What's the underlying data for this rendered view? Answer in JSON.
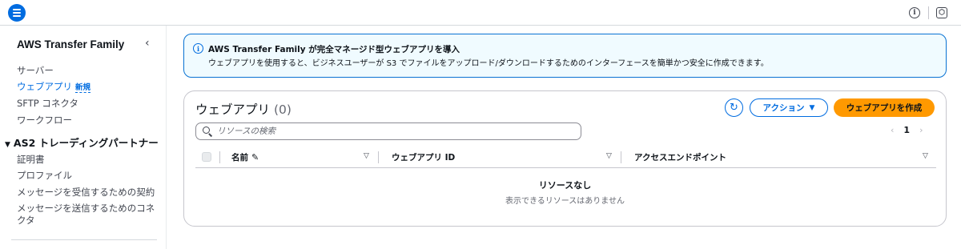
{
  "topbar": {
    "menu_icon": "hamburger-menu-icon",
    "info_icon": "info-icon",
    "settings_icon": "hexagon-gear-icon"
  },
  "sidebar": {
    "title": "AWS Transfer Family",
    "items": [
      {
        "label": "サーバー"
      },
      {
        "label": "ウェブアプリ",
        "badge": "新規",
        "active": true
      },
      {
        "label": "SFTP コネクタ"
      },
      {
        "label": "ワークフロー"
      }
    ],
    "section": {
      "label": "AS2 トレーディングパートナー",
      "items": [
        {
          "label": "証明書"
        },
        {
          "label": "プロファイル"
        },
        {
          "label": "メッセージを受信するための契約"
        },
        {
          "label": "メッセージを送信するためのコネクタ"
        }
      ]
    }
  },
  "banner": {
    "title": "AWS Transfer Family が完全マネージド型ウェブアプリを導入",
    "body": "ウェブアプリを使用すると、ビジネスユーザーが S3 でファイルをアップロード/ダウンロードするためのインターフェースを簡単かつ安全に作成できます。"
  },
  "webapps": {
    "title": "ウェブアプリ",
    "count": "(0)",
    "actions_label": "アクション",
    "create_label": "ウェブアプリを作成",
    "search_placeholder": "リソースの検索",
    "page": "1",
    "columns": [
      "名前",
      "ウェブアプリ ID",
      "アクセスエンドポイント"
    ],
    "empty_title": "リソースなし",
    "empty_subtitle": "表示できるリソースはありません"
  },
  "colors": {
    "accent": "#006ce0",
    "primary_button": "#ff9900",
    "banner_bg": "#f0fbff"
  }
}
